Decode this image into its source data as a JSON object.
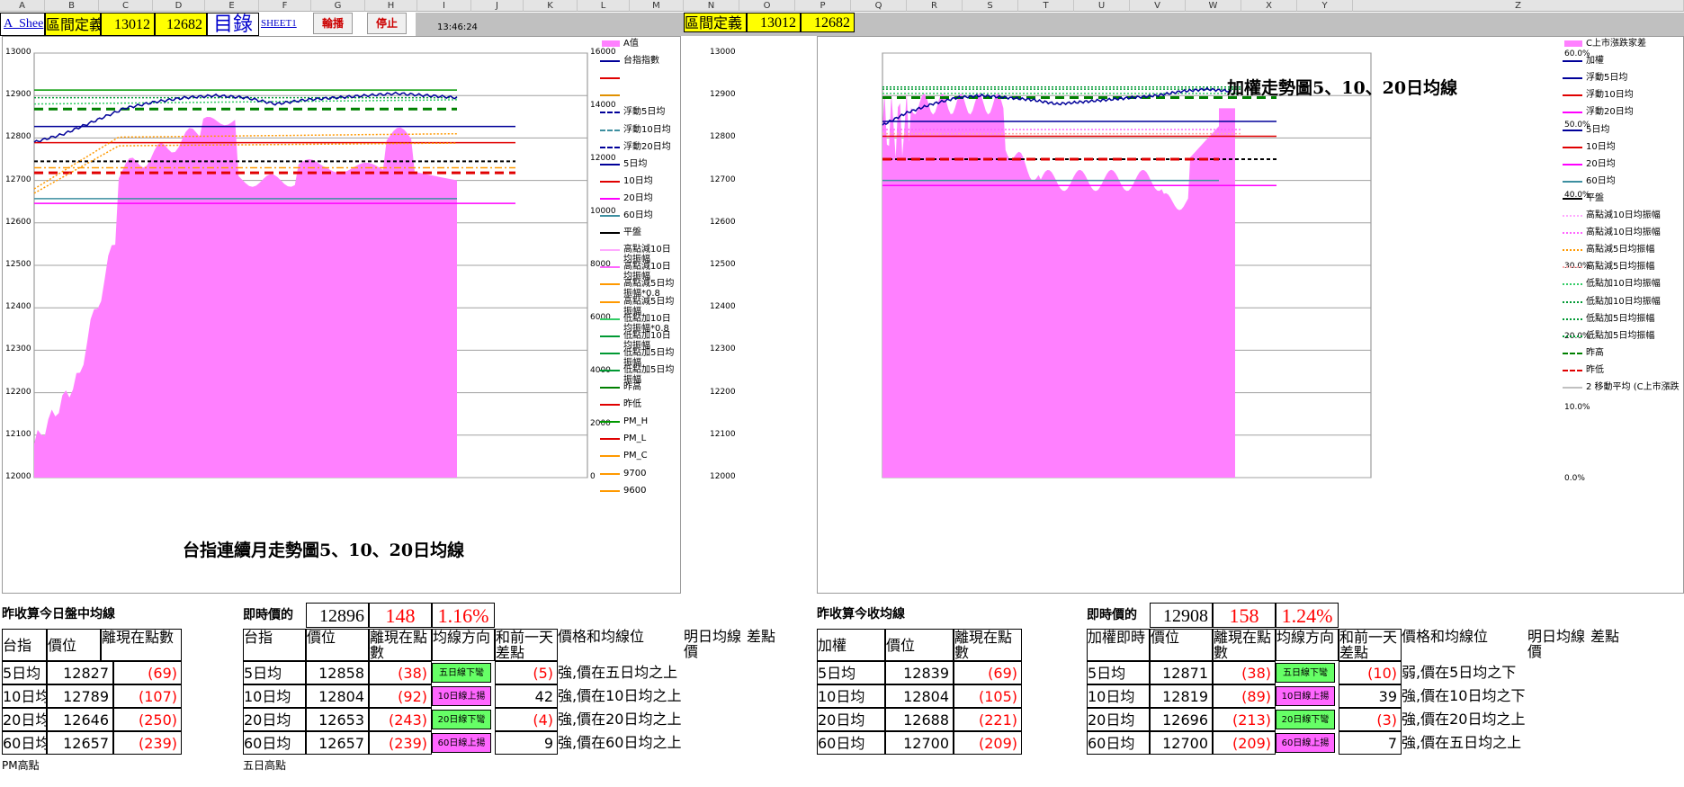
{
  "columns_left": [
    "A",
    "B",
    "C",
    "D",
    "E",
    "F",
    "G",
    "H",
    "I",
    "J",
    "K",
    "L",
    "M"
  ],
  "columns_right": [
    "N",
    "O",
    "P",
    "Q",
    "R",
    "S",
    "T",
    "U",
    "V",
    "W",
    "X",
    "Y",
    "Z"
  ],
  "top_bar": {
    "a_sheet": "A_Shee",
    "range_def_label": "區間定義",
    "range_hi": "13012",
    "range_lo": "12682",
    "catalog": "目錄",
    "sheet1": "SHEET1",
    "rotate_btn": "輪播",
    "stop_btn": "停止",
    "time": "13:46:24",
    "range_def_label_r": "區間定義",
    "range_hi_r": "13012",
    "range_lo_r": "12682"
  },
  "colors": {
    "pink": "#ff80ff",
    "navy": "#000099",
    "red": "#e00000",
    "green": "#009900",
    "teal": "#3d8fa0"
  },
  "left_chart": {
    "title": "台指連續月走勢圖5、10、20日均線",
    "y_ticks": [
      "13000",
      "12900",
      "12800",
      "12700",
      "12600",
      "12500",
      "12400",
      "12300",
      "12200",
      "12100",
      "12000"
    ],
    "y2_ticks": [
      "16000",
      "14000",
      "12000",
      "10000",
      "8000",
      "6000",
      "4000",
      "2000",
      "0"
    ],
    "legend": [
      "A值",
      "台指指數",
      "",
      "",
      "浮動5日均",
      "浮動10日均",
      "浮動20日均",
      "5日均",
      "10日均",
      "20日均",
      "60日均",
      "平盤",
      "高點減10日均振幅",
      "高點減10日均振幅",
      "高點減5日均振幅*0.8",
      "高點減5日均振幅",
      "低點加10日均振幅*0.8",
      "低點加10日均振幅",
      "低點加5日均振幅",
      "低點加5日均振幅",
      "昨高",
      "昨低",
      "PM_H",
      "PM_L",
      "PM_C",
      "9700",
      "9600"
    ]
  },
  "right_chart": {
    "title": "加權走勢圖5、10、20日均線",
    "y_ticks": [
      "13000",
      "12900",
      "12800",
      "12700",
      "12600",
      "12500",
      "12400",
      "12300",
      "12200",
      "12100",
      "12000"
    ],
    "y2_ticks": [
      "60.0%",
      "50.0%",
      "40.0%",
      "30.0%",
      "20.0%",
      "10.0%",
      "0.0%"
    ],
    "legend": [
      "C上市漲跌家差",
      "加權",
      "浮動5日均",
      "浮動10日均",
      "浮動20日均",
      "5日均",
      "10日均",
      "20日均",
      "60日均",
      "平盤",
      "高點減10日均振幅",
      "高點減10日均振幅",
      "高點減5日均振幅",
      "高點減5日均振幅",
      "低點加10日均振幅",
      "低點加10日均振幅",
      "低點加5日均振幅",
      "低點加5日均振幅",
      "昨高",
      "昨低",
      "2 移動平均 (C上市漲跌"
    ]
  },
  "chart_data": [
    {
      "type": "line",
      "title": "台指連續月走勢圖5、10、20日均線",
      "ylim": [
        12000,
        13000
      ],
      "series": [
        {
          "name": "台指指數",
          "values": [
            12790,
            12810,
            12840,
            12870,
            12885,
            12895,
            12900,
            12895,
            12880,
            12890,
            12895,
            12900,
            12905,
            12900,
            12895
          ]
        },
        {
          "name": "5日均",
          "values": [
            12827
          ]
        },
        {
          "name": "10日均",
          "values": [
            12789
          ]
        },
        {
          "name": "20日均",
          "values": [
            12646
          ]
        },
        {
          "name": "60日均",
          "values": [
            12657
          ]
        },
        {
          "name": "昨高",
          "values": [
            12868
          ]
        },
        {
          "name": "昨低",
          "values": [
            12718
          ]
        },
        {
          "name": "平盤",
          "values": [
            12745
          ]
        }
      ]
    },
    {
      "type": "line",
      "title": "加權走勢圖5、10、20日均線",
      "ylim": [
        12000,
        13000
      ],
      "series": [
        {
          "name": "加權",
          "values": [
            12830,
            12860,
            12880,
            12895,
            12900,
            12895,
            12890,
            12880,
            12885,
            12890,
            12895,
            12900,
            12910,
            12915,
            12910
          ]
        },
        {
          "name": "5日均",
          "values": [
            12839
          ]
        },
        {
          "name": "10日均",
          "values": [
            12804
          ]
        },
        {
          "name": "20日均",
          "values": [
            12688
          ]
        },
        {
          "name": "60日均",
          "values": [
            12700
          ]
        },
        {
          "name": "平盤",
          "values": [
            12750
          ]
        },
        {
          "name": "昨高",
          "values": [
            12895
          ]
        },
        {
          "name": "昨低",
          "values": [
            12750
          ]
        }
      ]
    }
  ],
  "tables": {
    "t1": {
      "title": "昨收算今日盤中均線",
      "headers": [
        "台指",
        "價位",
        "離現在點數"
      ],
      "rows": [
        [
          "5日均",
          "12827",
          "(69)"
        ],
        [
          "10日均",
          "12789",
          "(107)"
        ],
        [
          "20日均",
          "12646",
          "(250)"
        ],
        [
          "60日均",
          "12657",
          "(239)"
        ]
      ],
      "footer": "PM高點"
    },
    "t2": {
      "now_label": "即時價的",
      "now_price": "12896",
      "now_diff": "148",
      "now_pct": "1.16%",
      "headers": [
        "台指",
        "價位",
        "離現在點數",
        "均線方向",
        "和前一天差點",
        "價格和均線位",
        "明日均線價",
        "差點"
      ],
      "rows": [
        [
          "5日均",
          "12858",
          "(38)",
          "五日線下彎",
          "(5)",
          "強,價在五日均之上"
        ],
        [
          "10日均",
          "12804",
          "(92)",
          "10日線上揚",
          "42",
          "強,價在10日均之上"
        ],
        [
          "20日均",
          "12653",
          "(243)",
          "20日線下彎",
          "(4)",
          "強,價在20日均之上"
        ],
        [
          "60日均",
          "12657",
          "(239)",
          "60日線上揚",
          "9",
          "強,價在60日均之上"
        ]
      ],
      "footer": "五日高點"
    },
    "t3": {
      "title": "昨收算今收均線",
      "headers": [
        "加權",
        "價位",
        "離現在點數"
      ],
      "rows": [
        [
          "5日均",
          "12839",
          "(69)"
        ],
        [
          "10日均",
          "12804",
          "(105)"
        ],
        [
          "20日均",
          "12688",
          "(221)"
        ],
        [
          "60日均",
          "12700",
          "(209)"
        ]
      ]
    },
    "t4": {
      "now_label": "即時價的",
      "now_price": "12908",
      "now_diff": "158",
      "now_pct": "1.24%",
      "headers": [
        "加權即時",
        "價位",
        "離現在點數",
        "均線方向",
        "和前一天差點",
        "價格和均線位",
        "明日均線價",
        "差點"
      ],
      "rows": [
        [
          "5日均",
          "12871",
          "(38)",
          "五日線下彎",
          "(10)",
          "弱,價在5日均之下"
        ],
        [
          "10日均",
          "12819",
          "(89)",
          "10日線上揚",
          "39",
          "強,價在10日均之下"
        ],
        [
          "20日均",
          "12696",
          "(213)",
          "20日線下彎",
          "(3)",
          "強,價在20日均之上"
        ],
        [
          "60日均",
          "12700",
          "(209)",
          "60日線上揚",
          "7",
          "強,價在五日均之上"
        ]
      ]
    }
  }
}
